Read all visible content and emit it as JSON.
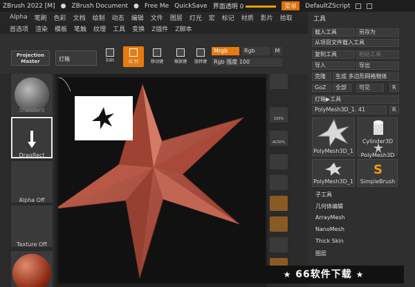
{
  "titlebar": {
    "app": "ZBrush 2022 [M]",
    "doc": "ZBrush Document",
    "free_mem": "Free Me",
    "quicksave": "QuickSave",
    "interface_trans": "界面透明 0",
    "menu": "菜单",
    "default_script": "DefaultZScript"
  },
  "menubar": [
    "Alpha",
    "笔刷",
    "色彩",
    "文档",
    "绘制",
    "动态",
    "编辑",
    "文件",
    "图层",
    "灯光",
    "宏",
    "标记",
    "材质",
    "影片",
    "拾取"
  ],
  "submenubar": [
    "首选项",
    "渲染",
    "模板",
    "笔触",
    "纹理",
    "工具",
    "变换",
    "Z插件",
    "Z脚本"
  ],
  "toolshelf": {
    "projection_master": "Projection Master",
    "light_box": "灯箱",
    "icons": [
      {
        "name": "edit",
        "label": "Edit"
      },
      {
        "name": "draw",
        "label": "绘 制"
      },
      {
        "name": "move",
        "label": "移动键"
      },
      {
        "name": "scale",
        "label": "缩放键"
      },
      {
        "name": "rotate",
        "label": "旋转键"
      }
    ],
    "mrgb": "Mrgb",
    "rgb": "Rgb",
    "m": "M",
    "rgb_intensity": "Rgb 强度 100"
  },
  "leftpanel": {
    "standard": "Standard",
    "dragrect": "DragRect",
    "alpha_off": "Alpha Off",
    "texture_off": "Texture Off"
  },
  "rightstrip": [
    "",
    "100%",
    "AC50%",
    "",
    "",
    "",
    "",
    "",
    ""
  ],
  "panel": {
    "title": "工具",
    "load_tool": "载入工具",
    "save_as": "另存为",
    "load_from_project": "从项目文件载入工具",
    "copy_tool": "复制工具",
    "paste_tool": "粘贴工具",
    "import": "导入",
    "export": "导出",
    "clone": "克隆",
    "make_polymesh": "生成 多边形网格物体",
    "goz": "GoZ",
    "all": "全部",
    "visible": "可见",
    "r": "R",
    "lightbox_tool": "灯箱▶工具",
    "current_tool": "PolyMesh3D_1. 41",
    "tools": [
      {
        "label": "PolyMesh3D_1"
      },
      {
        "label": "Cylinder3D"
      },
      {
        "label": "PolyMesh3D"
      },
      {
        "label": "PolyMesh3D_1"
      },
      {
        "label": "SimpleBrush"
      }
    ],
    "subtools": [
      "子工具",
      "几何体编辑",
      "ArrayMesh",
      "NanoMesh",
      "Thick Skin",
      "图层"
    ]
  },
  "watermark": "66软件下载",
  "colors": {
    "accent": "#e77b10",
    "star": "#b25444",
    "canvas_bg": "#111111"
  }
}
